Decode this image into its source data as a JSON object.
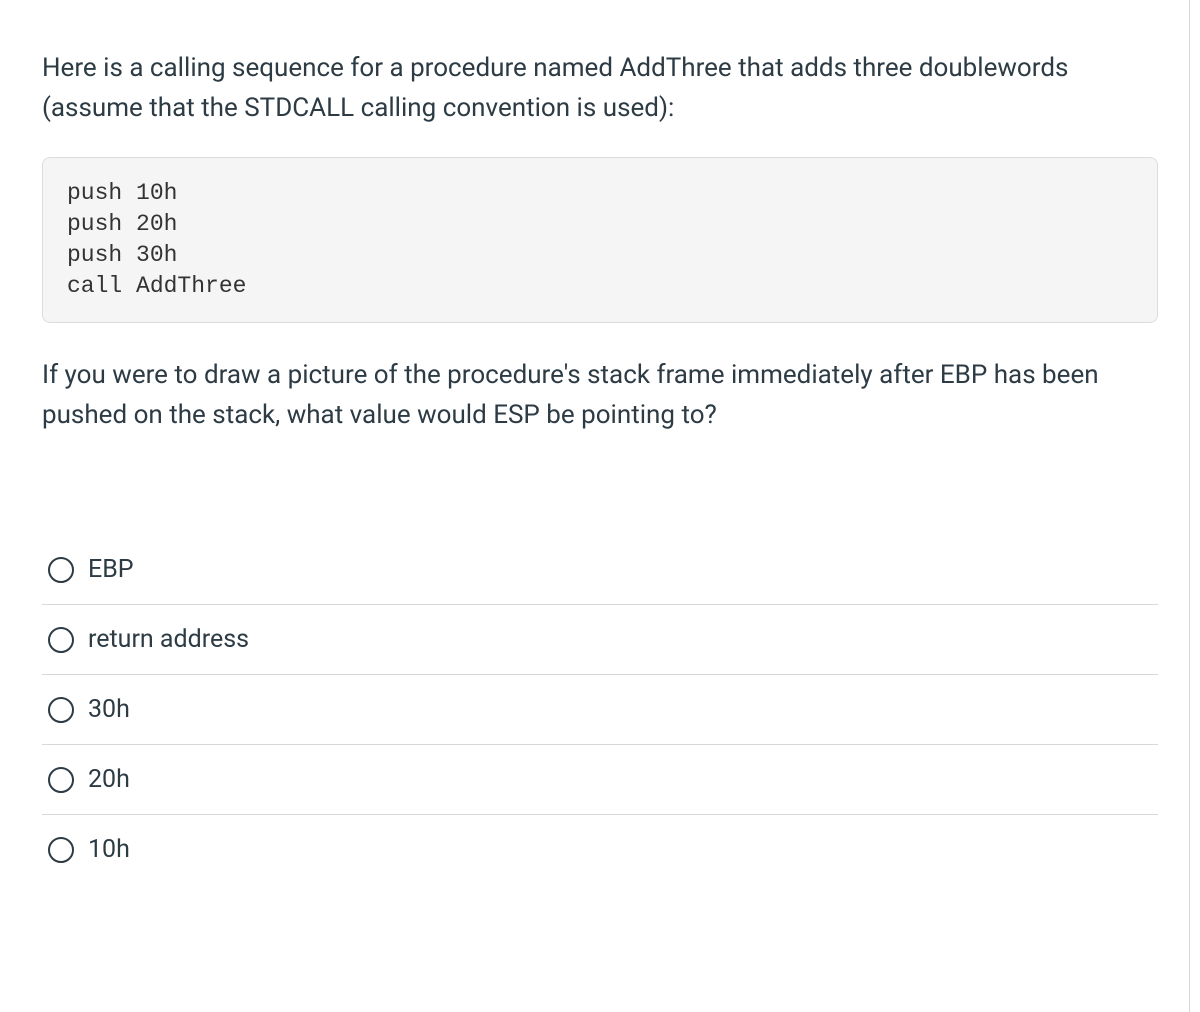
{
  "question": {
    "intro": "Here is a calling sequence for a procedure named AddThree that adds three doublewords (assume that the STDCALL calling convention is used):",
    "code": "push 10h\npush 20h\npush 30h\ncall AddThree",
    "prompt": "If you were to draw a picture of the procedure's stack frame immediately after EBP has been pushed on the stack, what value would ESP be pointing to?"
  },
  "options": [
    {
      "label": "EBP"
    },
    {
      "label": "return address"
    },
    {
      "label": "30h"
    },
    {
      "label": "20h"
    },
    {
      "label": "10h"
    }
  ]
}
